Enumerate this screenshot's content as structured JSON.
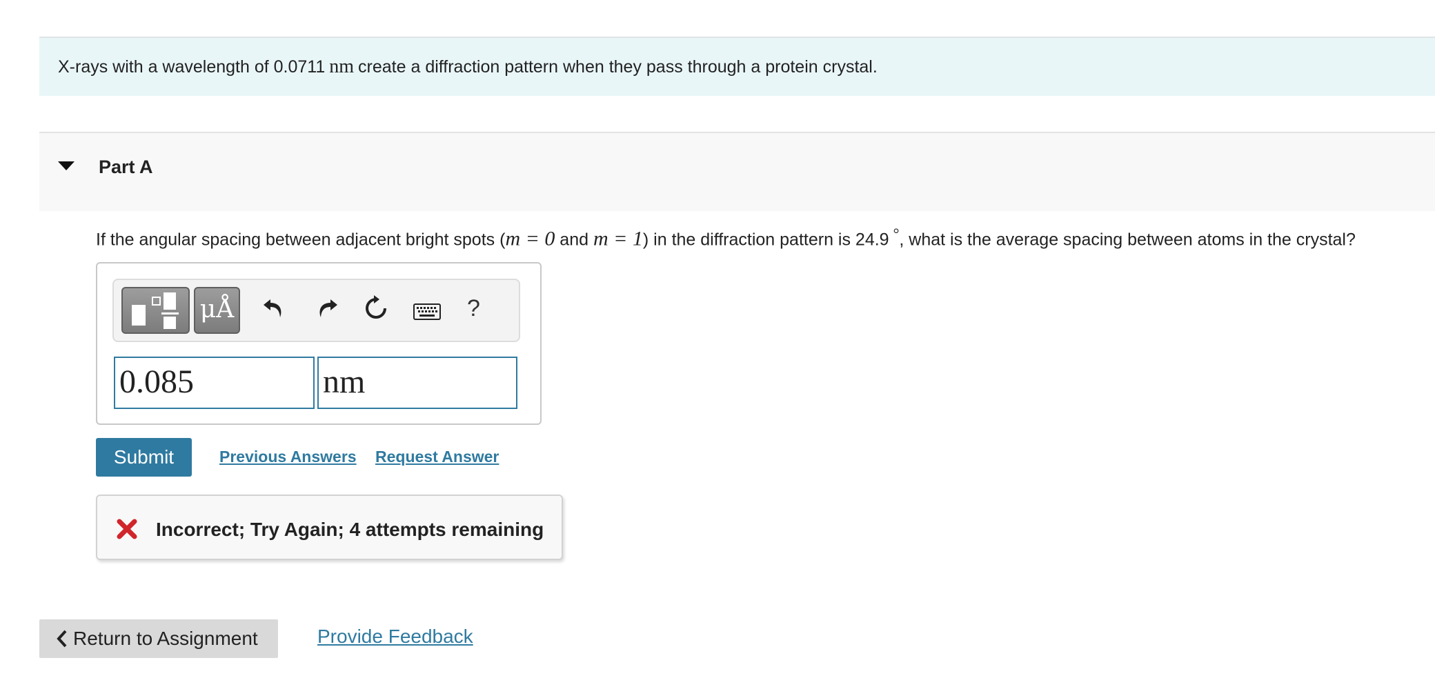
{
  "intro": {
    "text_before": "X-rays with a wavelength of 0.0711",
    "unit": "nm",
    "text_after": "create a diffraction pattern when they pass through a protein crystal."
  },
  "part": {
    "title": "Part A"
  },
  "question": {
    "t1": "If the angular spacing between adjacent bright spots (",
    "m0": "m = 0",
    "t2": " and ",
    "m1": "m = 1",
    "t3": ") in the diffraction pattern is 24.9",
    "deg": "°",
    "t4": ", what is the average spacing between atoms in the crystal?"
  },
  "toolbar": {
    "units_label": "μÅ",
    "help_label": "?",
    "icons": [
      "templates-icon",
      "units-icon",
      "undo-icon",
      "redo-icon",
      "reset-icon",
      "keyboard-icon",
      "help-icon"
    ]
  },
  "answer": {
    "value": "0.085",
    "unit": "nm"
  },
  "actions": {
    "submit_label": "Submit",
    "previous_answers_label": "Previous Answers",
    "request_answer_label": "Request Answer"
  },
  "feedback": {
    "message": "Incorrect; Try Again; 4 attempts remaining",
    "status_color": "#d0262b"
  },
  "footer": {
    "return_label": "Return to Assignment",
    "feedback_link_label": "Provide Feedback"
  },
  "colors": {
    "accent": "#2f7aa0",
    "intro_bg": "#e9f6f8"
  }
}
